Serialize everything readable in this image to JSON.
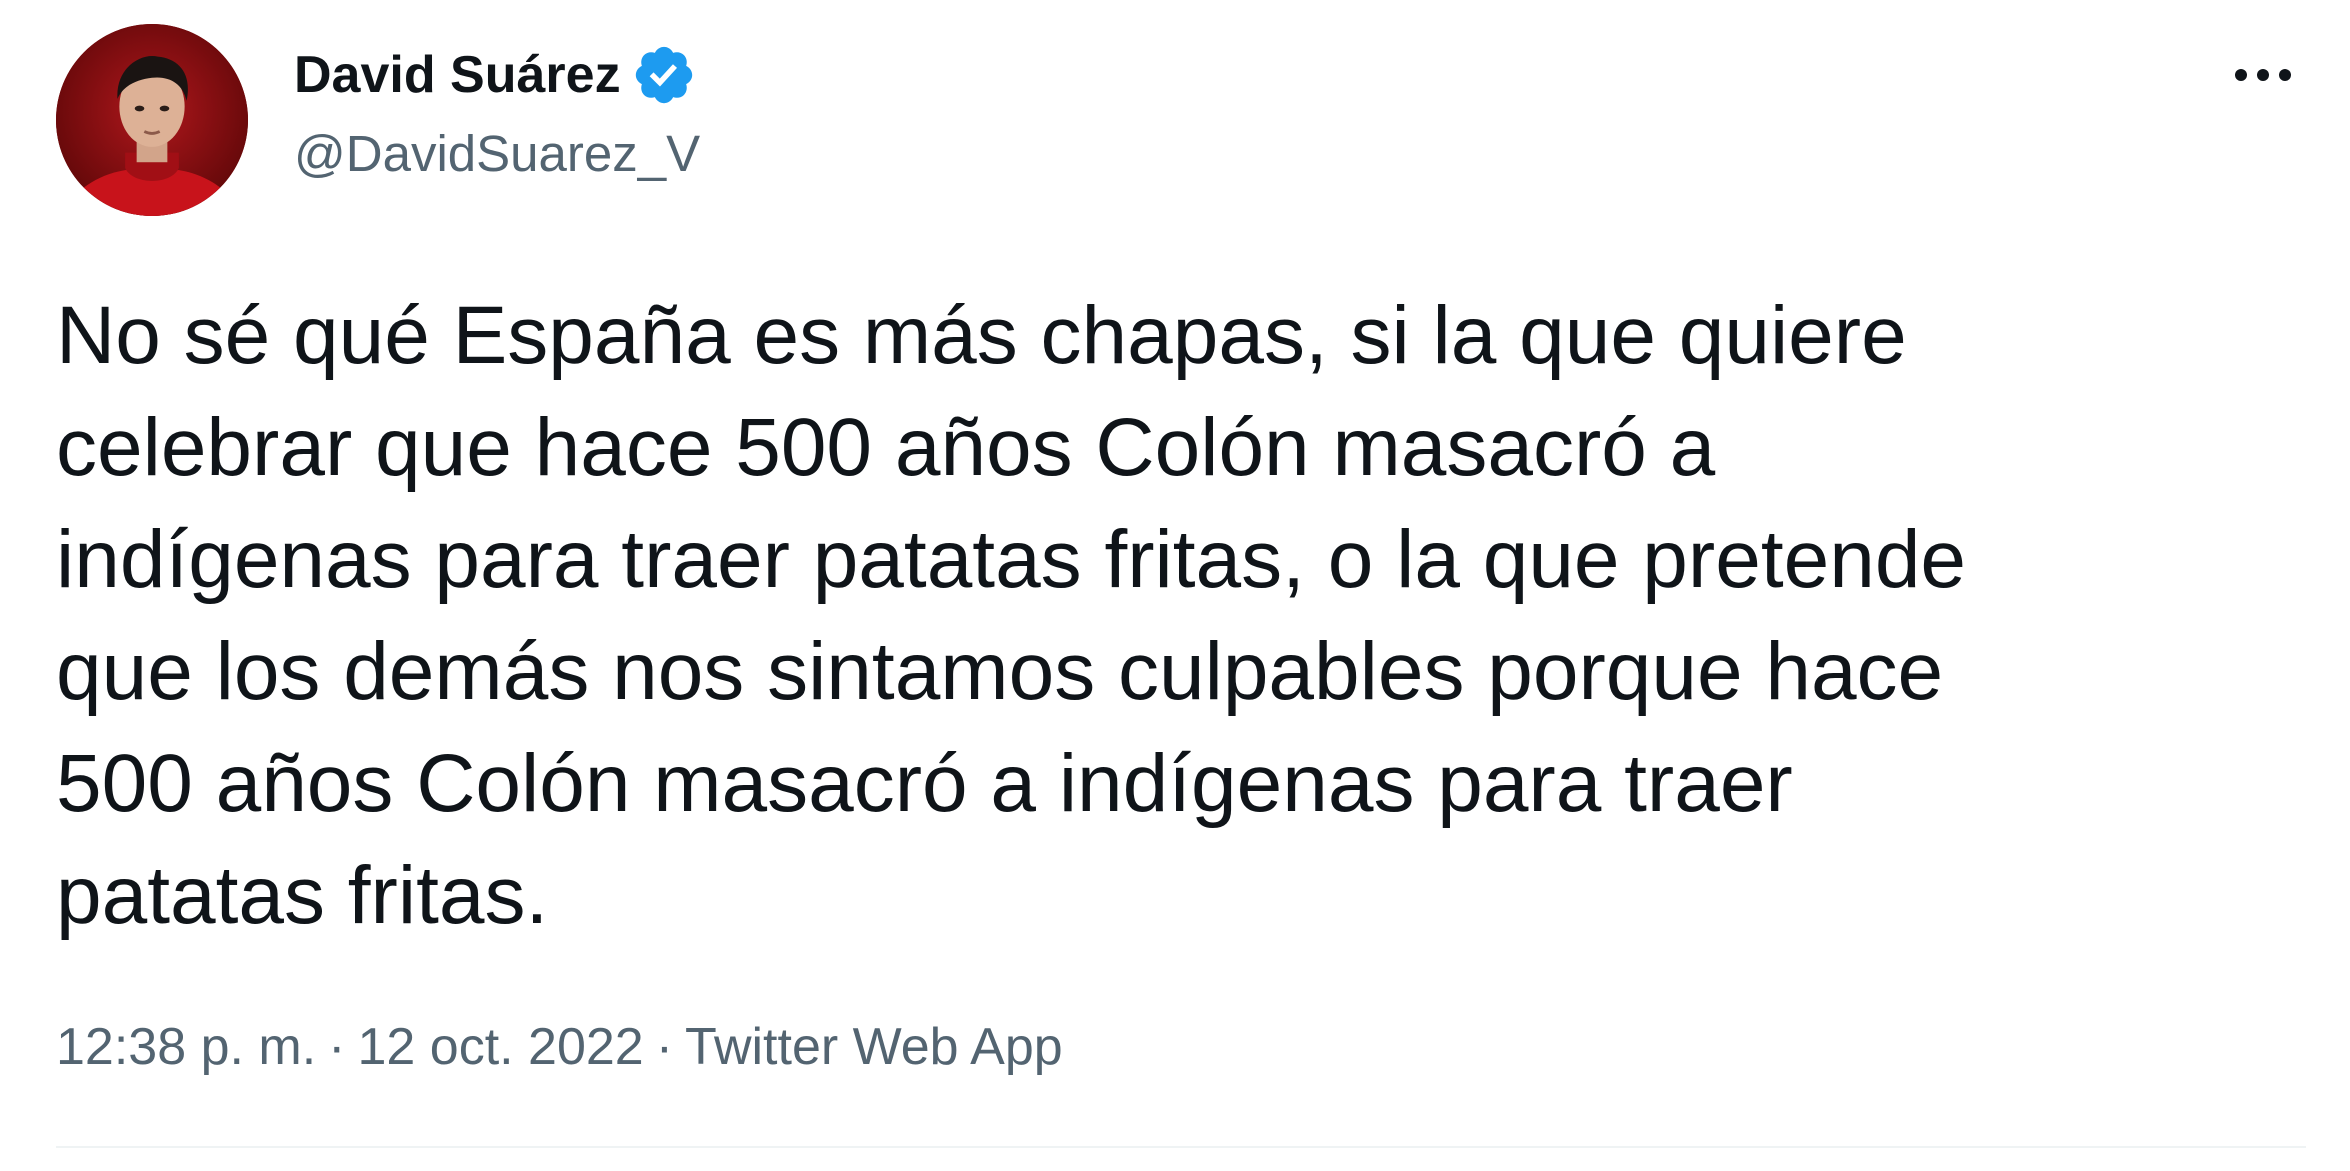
{
  "author": {
    "display_name": "David Suárez",
    "handle": "@DavidSuarez_V",
    "verified_icon": "verified-badge-icon",
    "avatar_icon": "profile-photo"
  },
  "tweet": {
    "text": "No sé qué España es más chapas, si la que quiere\ncelebrar que hace 500 años Colón masacró a\nindígenas para traer patatas fritas, o la que pretende\nque los demás nos sintamos culpables porque hace\n500 años Colón masacró a indígenas para traer\npatatas fritas.",
    "time": "12:38 p. m.",
    "separator": "·",
    "date": "12 oct. 2022",
    "source": "Twitter Web App"
  },
  "actions": {
    "more_icon": "more-horizontal-icon"
  },
  "colors": {
    "text_primary": "#0f1419",
    "text_secondary": "#536471",
    "verified_blue": "#1d9bf0",
    "divider": "#eff3f4",
    "avatar_background": "#7a0c0e"
  }
}
